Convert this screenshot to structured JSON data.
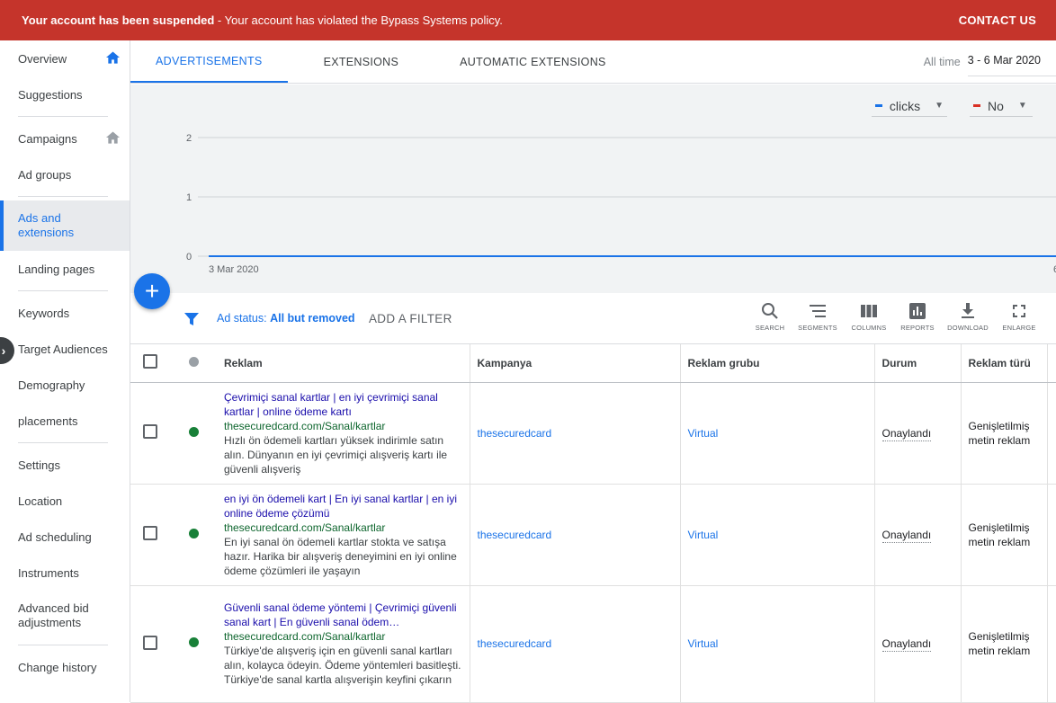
{
  "banner": {
    "bold": "Your account has been suspended",
    "message": " - Your account has violated the Bypass Systems policy.",
    "contact": "CONTACT US",
    "bg_color": "#c5342b"
  },
  "sidebar": {
    "items": [
      {
        "label": "Overview",
        "icon": "home-icon"
      },
      {
        "label": "Suggestions"
      },
      {
        "label": "Campaigns",
        "icon": "home-icon"
      },
      {
        "label": "Ad groups"
      },
      {
        "label": "Ads and extensions",
        "active": true
      },
      {
        "label": "Landing pages"
      },
      {
        "label": "Keywords"
      },
      {
        "label": "Target Audiences"
      },
      {
        "label": "Demography"
      },
      {
        "label": "placements"
      },
      {
        "label": "Settings"
      },
      {
        "label": "Location"
      },
      {
        "label": "Ad scheduling"
      },
      {
        "label": "Instruments"
      },
      {
        "label": "Advanced bid adjustments"
      },
      {
        "label": "Change history"
      }
    ]
  },
  "tabs": [
    {
      "label": "ADVERTISEMENTS",
      "active": true
    },
    {
      "label": "EXTENSIONS"
    },
    {
      "label": "AUTOMATIC EXTENSIONS"
    }
  ],
  "daterange": {
    "label": "All time",
    "value": "3 - 6 Mar 2020"
  },
  "chart": {
    "metric1": "clicks",
    "metric1_color": "#1a73e8",
    "metric2": "No",
    "metric2_color": "#d93025",
    "y_ticks": [
      "2",
      "1",
      "0"
    ],
    "x_label_start": "3 Mar 2020",
    "x_label_end": "6"
  },
  "chart_data": {
    "type": "line",
    "x": [
      "3 Mar 2020",
      "6"
    ],
    "series": [
      {
        "name": "clicks",
        "values": [
          0,
          0
        ]
      }
    ],
    "ylim": [
      0,
      2
    ],
    "grid": true
  },
  "filterbar": {
    "ad_status_label": "Ad status:",
    "ad_status_value": "All but removed",
    "add_filter": "ADD A FILTER",
    "tools": [
      "SEARCH",
      "SEGMENTS",
      "COLUMNS",
      "REPORTS",
      "DOWNLOAD",
      "ENLARGE"
    ]
  },
  "table": {
    "headers": [
      "Reklam",
      "Kampanya",
      "Reklam grubu",
      "Durum",
      "Reklam türü"
    ],
    "rows": [
      {
        "title": "Çevrimiçi sanal kartlar | en iyi çevrimiçi sanal kartlar | online ödeme kartı",
        "url": "thesecuredcard.com/Sanal/kartlar",
        "desc": "Hızlı ön ödemeli kartları yüksek indirimle satın alın. Dünyanın en iyi çevrimiçi alışveriş kartı ile güvenli alışveriş",
        "campaign": "thesecuredcard",
        "adgroup": "Virtual",
        "status": "Onaylandı",
        "type": "Genişletilmiş metin reklam"
      },
      {
        "title": "en iyi ön ödemeli kart | En iyi sanal kartlar | en iyi online ödeme çözümü",
        "url": "thesecuredcard.com/Sanal/kartlar",
        "desc": "En iyi sanal ön ödemeli kartlar stokta ve satışa hazır. Harika bir alışveriş deneyimini en iyi online ödeme çözümleri ile yaşayın",
        "campaign": "thesecuredcard",
        "adgroup": "Virtual",
        "status": "Onaylandı",
        "type": "Genişletilmiş metin reklam"
      },
      {
        "title": "Güvenli sanal ödeme yöntemi | Çevrimiçi güvenli sanal kart | En güvenli sanal ödem…",
        "url": "thesecuredcard.com/Sanal/kartlar",
        "desc": "Türkiye'de alışveriş için en güvenli sanal kartları alın, kolayca ödeyin. Ödeme yöntemleri basitleşti. Türkiye'de sanal kartla alışverişin keyfini çıkarın",
        "campaign": "thesecuredcard",
        "adgroup": "Virtual",
        "status": "Onaylandı",
        "type": "Genişletilmiş metin reklam"
      }
    ]
  }
}
